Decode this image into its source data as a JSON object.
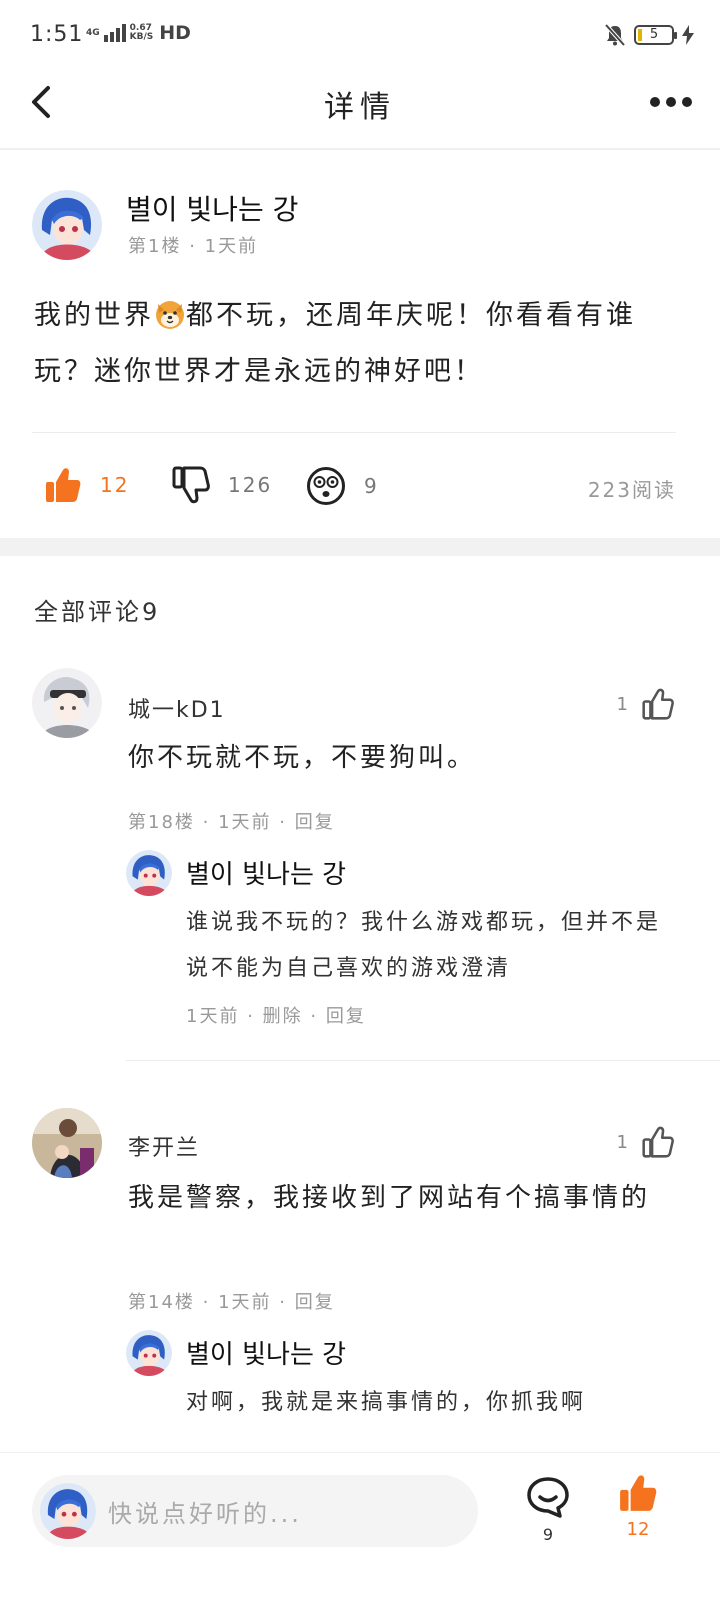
{
  "status_bar": {
    "time": "1:51",
    "network": "4G",
    "speed_value": "0.67",
    "speed_unit": "KB/S",
    "hd": "HD",
    "battery": "5"
  },
  "header": {
    "title": "详情"
  },
  "post": {
    "author": "별이 빛나는 강",
    "floor": "第1楼",
    "time": "1天前",
    "text_part1": "我的世界",
    "text_part2": "都不玩，还周年庆呢！你看看有谁玩？迷你世界才是永远的神好吧！",
    "likes": "12",
    "dislikes": "126",
    "reactions": "9",
    "reads": "223阅读"
  },
  "comments_section": {
    "title": "全部评论9"
  },
  "comments": [
    {
      "author": "城一kD1",
      "likes": "1",
      "text": "你不玩就不玩，不要狗叫。",
      "floor": "第18楼",
      "time": "1天前",
      "reply_label": "回复",
      "reply": {
        "author": "별이 빛나는 강",
        "text": "谁说我不玩的？我什么游戏都玩，但并不是说不能为自己喜欢的游戏澄清",
        "time": "1天前",
        "delete_label": "删除",
        "reply_label": "回复"
      }
    },
    {
      "author": "李开兰",
      "likes": "1",
      "text": "我是警察，我接收到了网站有个搞事情的",
      "floor": "第14楼",
      "time": "1天前",
      "reply_label": "回复",
      "reply": {
        "author": "별이 빛나는 강",
        "text": "对啊，我就是来搞事情的，你抓我啊"
      }
    }
  ],
  "bottom_bar": {
    "placeholder": "快说点好听的...",
    "comment_count": "9",
    "like_count": "12"
  },
  "colors": {
    "accent": "#f5731e",
    "muted": "#999999"
  }
}
